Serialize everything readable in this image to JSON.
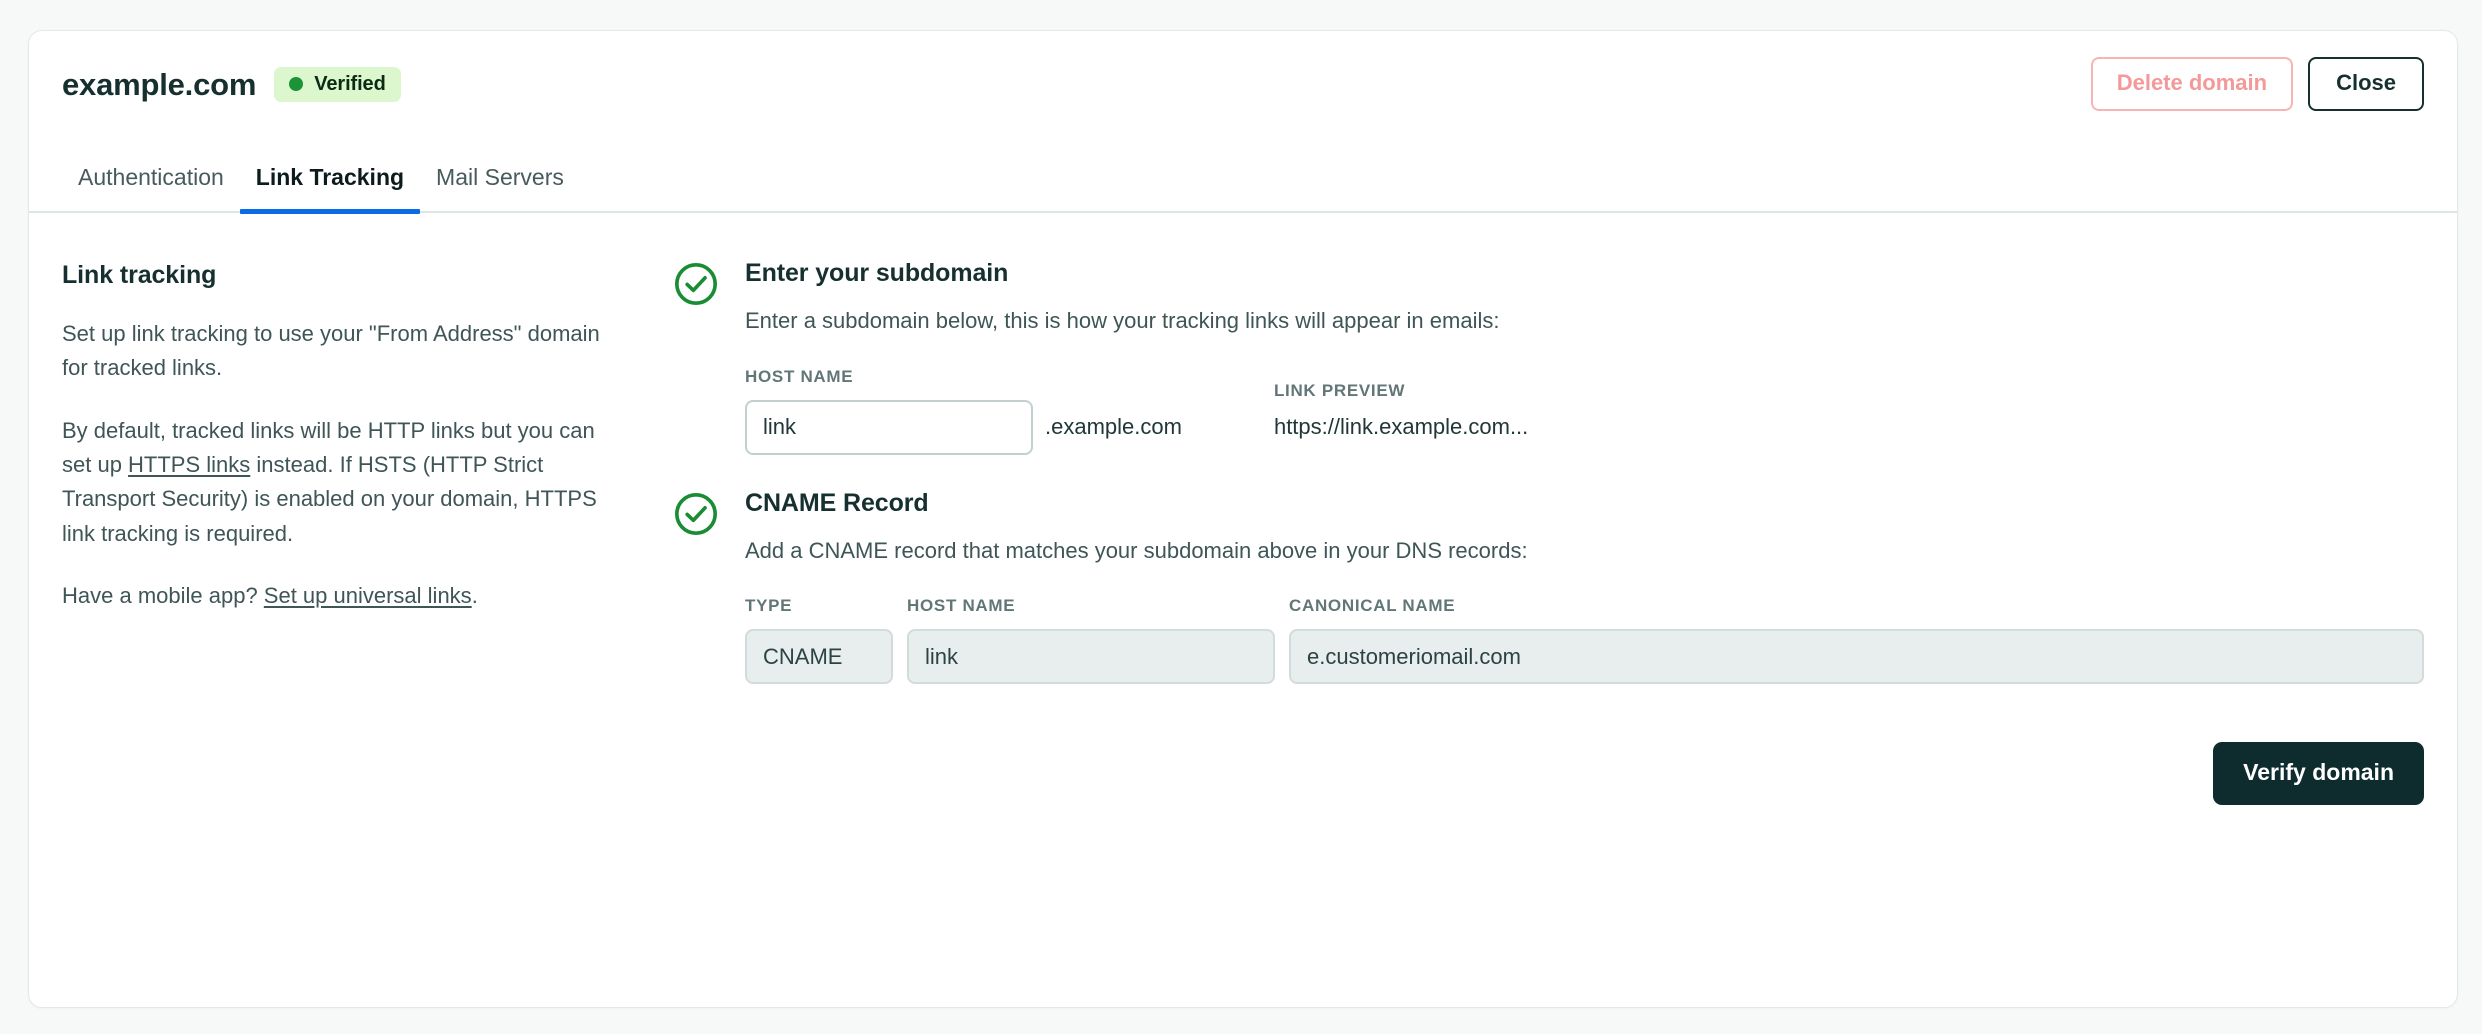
{
  "header": {
    "domain": "example.com",
    "status_badge": "Verified",
    "status_color": "#1a9437",
    "status_bg": "#dcf7cd",
    "delete_label": "Delete domain",
    "close_label": "Close"
  },
  "tabs": [
    {
      "label": "Authentication",
      "active": false
    },
    {
      "label": "Link Tracking",
      "active": true
    },
    {
      "label": "Mail Servers",
      "active": false
    }
  ],
  "tab_accent_color": "#0a6ae8",
  "left": {
    "title": "Link tracking",
    "paragraph_1": "Set up link tracking to use your \"From Address\" domain for tracked links.",
    "paragraph_2_part_1": "By default, tracked links will be HTTP links but you can set up ",
    "paragraph_2_link": "HTTPS links",
    "paragraph_2_part_2": " instead. If HSTS (HTTP Strict Transport Security) is enabled on your domain, HTTPS link tracking is required.",
    "paragraph_3_part_1": "Have a mobile app? ",
    "paragraph_3_link": "Set up universal links",
    "paragraph_3_part_2": "."
  },
  "steps": [
    {
      "icon": "check-circle-icon",
      "icon_color": "#1a8c34",
      "title": "Enter your subdomain",
      "description": "Enter a subdomain below, this is how your tracking links will appear in emails:",
      "hostname_label": "HOST NAME",
      "hostname_value": "link",
      "hostname_placeholder": "link",
      "domain_suffix": ".example.com",
      "preview_label": "LINK PREVIEW",
      "preview_value": "https://link.example.com..."
    },
    {
      "icon": "check-circle-icon",
      "icon_color": "#1a8c34",
      "title": "CNAME Record",
      "description": "Add a CNAME record that matches your subdomain above in your DNS records:",
      "type_label": "TYPE",
      "type_value": "CNAME",
      "hostname_label": "HOST NAME",
      "hostname_value": "link",
      "canonical_label": "CANONICAL NAME",
      "canonical_value": "e.customeriomail.com"
    }
  ],
  "footer": {
    "verify_label": "Verify domain",
    "verify_bg": "#0e2c2e"
  }
}
